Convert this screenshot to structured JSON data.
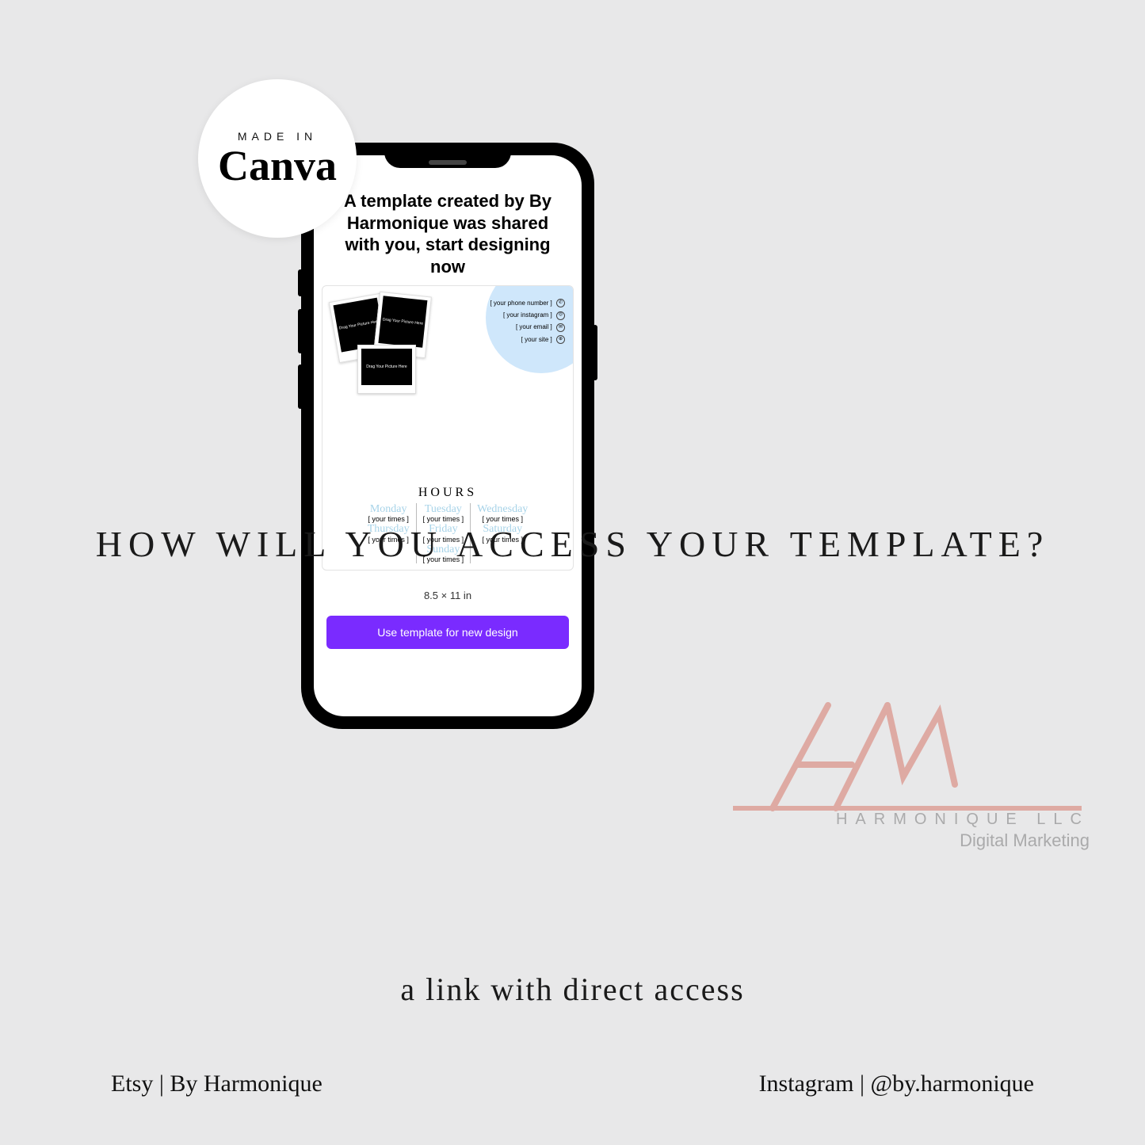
{
  "badge": {
    "made_in": "MADE IN",
    "canva": "Canva"
  },
  "screen": {
    "title": "A template created by By Harmonique was shared with you, start designing now",
    "polaroid_text": "Drag Your Picture Here",
    "contacts": {
      "phone": "[ your phone number ]",
      "instagram": "[ your instagram ]",
      "email": "[ your email ]",
      "site": "[ your site ]"
    },
    "hours_heading": "HOURS",
    "days": {
      "mon": "Monday",
      "tue": "Tuesday",
      "wed": "Wednesday",
      "thu": "Thursday",
      "fri": "Friday",
      "sat": "Saturday",
      "sun": "Sunday"
    },
    "times_placeholder": "[ your times ]",
    "dimensions": "8.5 × 11 in",
    "cta": "Use template for new design"
  },
  "headline": "HOW WILL YOU ACCESS YOUR TEMPLATE?",
  "subtitle": "a link with direct access",
  "footer": {
    "etsy": "Etsy | By Harmonique",
    "instagram": "Instagram | @by.harmonique"
  },
  "watermark": {
    "company": "HARMONIQUE LLC",
    "tag": "Digital Marketing"
  }
}
